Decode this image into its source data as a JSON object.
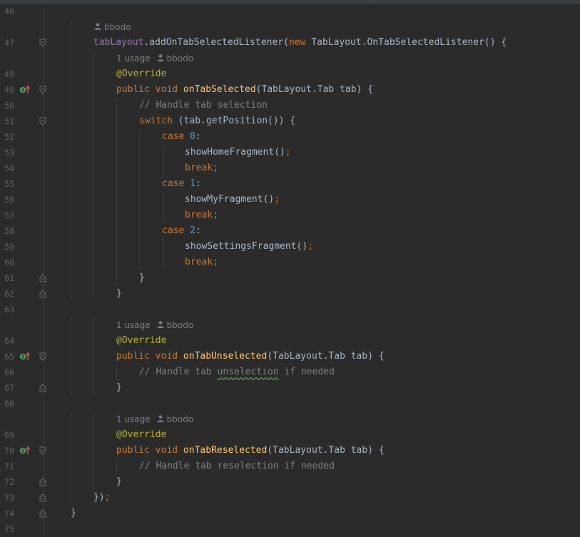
{
  "editor": {
    "colors": {
      "background": "#2b2b2b",
      "keyword": "#cc7832",
      "method": "#ffc66d",
      "field": "#9876aa",
      "number": "#6897bb",
      "comment": "#808080",
      "annotation": "#bbb529",
      "text": "#a9b7c6"
    },
    "hints": {
      "author": "bbodo",
      "usage": "1 usage"
    },
    "lines": [
      {
        "n": "46"
      },
      {
        "n": "47",
        "tokens": [
          {
            "t": "tabLayout",
            "c": "field"
          },
          {
            "t": ".addOnTabSelectedListener(",
            "c": "plain"
          },
          {
            "t": "new",
            "c": "kw"
          },
          {
            "t": " TabLayout.OnTabSelectedListener() {",
            "c": "plain"
          }
        ]
      },
      {
        "n": "48",
        "tokens": [
          {
            "t": "@Override",
            "c": "ann"
          }
        ]
      },
      {
        "n": "49",
        "tokens": [
          {
            "t": "public void ",
            "c": "kw"
          },
          {
            "t": "onTabSelected",
            "c": "fn"
          },
          {
            "t": "(TabLayout.Tab tab) {",
            "c": "plain"
          }
        ]
      },
      {
        "n": "50",
        "tokens": [
          {
            "t": "// Handle tab selection",
            "c": "cmt"
          }
        ]
      },
      {
        "n": "51",
        "tokens": [
          {
            "t": "switch",
            "c": "kw"
          },
          {
            "t": " (tab.getPosition()) {",
            "c": "plain"
          }
        ]
      },
      {
        "n": "52",
        "tokens": [
          {
            "t": "case ",
            "c": "kw"
          },
          {
            "t": "0",
            "c": "num"
          },
          {
            "t": ":",
            "c": "plain"
          }
        ]
      },
      {
        "n": "53",
        "tokens": [
          {
            "t": "showHomeFragment()",
            "c": "plain"
          },
          {
            "t": ";",
            "c": "kw"
          }
        ]
      },
      {
        "n": "54",
        "tokens": [
          {
            "t": "break;",
            "c": "kw"
          }
        ]
      },
      {
        "n": "55",
        "tokens": [
          {
            "t": "case ",
            "c": "kw"
          },
          {
            "t": "1",
            "c": "num"
          },
          {
            "t": ":",
            "c": "plain"
          }
        ]
      },
      {
        "n": "56",
        "tokens": [
          {
            "t": "showMyFragment()",
            "c": "plain"
          },
          {
            "t": ";",
            "c": "kw"
          }
        ]
      },
      {
        "n": "57",
        "tokens": [
          {
            "t": "break;",
            "c": "kw"
          }
        ]
      },
      {
        "n": "58",
        "tokens": [
          {
            "t": "case ",
            "c": "kw"
          },
          {
            "t": "2",
            "c": "num"
          },
          {
            "t": ":",
            "c": "plain"
          }
        ]
      },
      {
        "n": "59",
        "tokens": [
          {
            "t": "showSettingsFragment()",
            "c": "plain"
          },
          {
            "t": ";",
            "c": "kw"
          }
        ]
      },
      {
        "n": "60",
        "tokens": [
          {
            "t": "break;",
            "c": "kw"
          }
        ]
      },
      {
        "n": "61",
        "tokens": [
          {
            "t": "}",
            "c": "plain"
          }
        ]
      },
      {
        "n": "62",
        "tokens": [
          {
            "t": "}",
            "c": "plain"
          }
        ]
      },
      {
        "n": "63"
      },
      {
        "n": "64",
        "tokens": [
          {
            "t": "@Override",
            "c": "ann"
          }
        ]
      },
      {
        "n": "65",
        "tokens": [
          {
            "t": "public void ",
            "c": "kw"
          },
          {
            "t": "onTabUnselected",
            "c": "fn"
          },
          {
            "t": "(TabLayout.Tab tab) {",
            "c": "plain"
          }
        ]
      },
      {
        "n": "66",
        "tokens": [
          {
            "t": "// Handle tab ",
            "c": "cmt"
          },
          {
            "t": "unselection",
            "c": "cmt-squig"
          },
          {
            "t": " if needed",
            "c": "cmt"
          }
        ]
      },
      {
        "n": "67",
        "tokens": [
          {
            "t": "}",
            "c": "plain"
          }
        ]
      },
      {
        "n": "68"
      },
      {
        "n": "69",
        "tokens": [
          {
            "t": "@Override",
            "c": "ann"
          }
        ]
      },
      {
        "n": "70",
        "tokens": [
          {
            "t": "public void ",
            "c": "kw"
          },
          {
            "t": "onTabReselected",
            "c": "fn"
          },
          {
            "t": "(TabLayout.Tab tab) {",
            "c": "plain"
          }
        ]
      },
      {
        "n": "71",
        "tokens": [
          {
            "t": "// Handle tab reselection if needed",
            "c": "cmt"
          }
        ]
      },
      {
        "n": "72",
        "tokens": [
          {
            "t": "}",
            "c": "plain"
          }
        ]
      },
      {
        "n": "73",
        "tokens": [
          {
            "t": "})",
            "c": "plain"
          },
          {
            "t": ";",
            "c": "kw"
          }
        ]
      },
      {
        "n": "74",
        "tokens": [
          {
            "t": "}",
            "c": "plain"
          }
        ]
      },
      {
        "n": "75"
      }
    ]
  }
}
